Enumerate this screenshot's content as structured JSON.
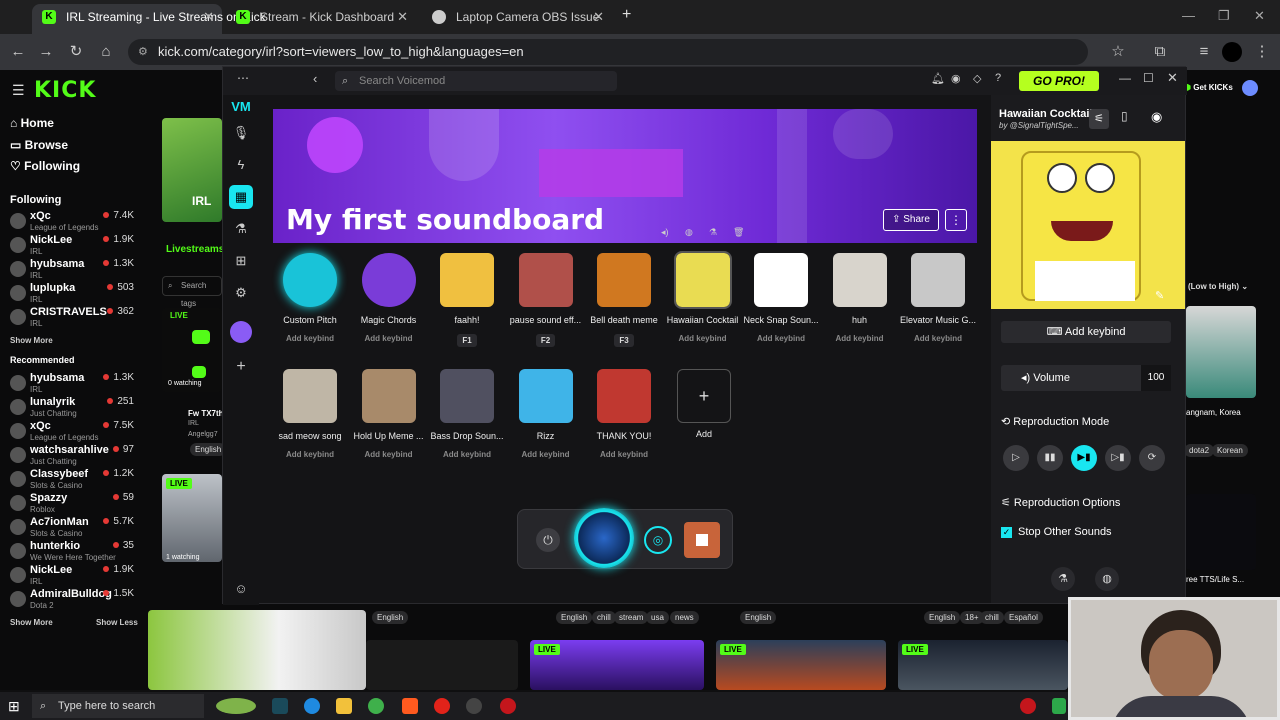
{
  "browser": {
    "tabs": [
      {
        "title": "IRL Streaming - Live Streams on Kick",
        "active": true
      },
      {
        "title": "Stream - Kick Dashboard",
        "active": false
      },
      {
        "title": "Laptop Camera OBS Issue",
        "active": false
      }
    ],
    "url": "kick.com/category/irl?sort=viewers_low_to_high&languages=en"
  },
  "kick": {
    "nav": [
      "Home",
      "Browse",
      "Following"
    ],
    "following_header": "Following",
    "following": [
      {
        "name": "xQc",
        "cat": "League of Legends",
        "viewers": "7.4K"
      },
      {
        "name": "NickLee",
        "cat": "IRL",
        "viewers": "1.9K"
      },
      {
        "name": "hyubsama",
        "cat": "IRL",
        "viewers": "1.3K"
      },
      {
        "name": "luplupka",
        "cat": "IRL",
        "viewers": "503"
      },
      {
        "name": "CRISTRAVELS",
        "cat": "IRL",
        "viewers": "362"
      }
    ],
    "show_more": "Show More",
    "recommended_header": "Recommended",
    "recommended": [
      {
        "name": "hyubsama",
        "cat": "IRL",
        "viewers": "1.3K"
      },
      {
        "name": "lunalyrik",
        "cat": "Just Chatting",
        "viewers": "251"
      },
      {
        "name": "xQc",
        "cat": "League of Legends",
        "viewers": "7.5K"
      },
      {
        "name": "watchsarahlive",
        "cat": "Just Chatting",
        "viewers": "97"
      },
      {
        "name": "Classybeef",
        "cat": "Slots & Casino",
        "viewers": "1.2K"
      },
      {
        "name": "Spazzy",
        "cat": "Roblox",
        "viewers": "59"
      },
      {
        "name": "Ac7ionMan",
        "cat": "Slots & Casino",
        "viewers": "5.7K"
      },
      {
        "name": "hunterkio",
        "cat": "We Were Here Together",
        "viewers": "35"
      },
      {
        "name": "NickLee",
        "cat": "IRL",
        "viewers": "1.9K"
      },
      {
        "name": "AdmiralBulldog",
        "cat": "Dota 2",
        "viewers": "1.5K"
      }
    ],
    "show_less": "Show Less",
    "irl_label": "IRL",
    "livestreams_label": "Livestreams",
    "search_tags_placeholder": "Search tags",
    "live": "LIVE",
    "watching_0": "0 watching",
    "watching_1": "1 watching",
    "card_title": "Fw TX7th",
    "card_cat": "IRL",
    "card_user": "Angelgg7",
    "lang_english": "English",
    "get_kicks": "Get KICKs",
    "sort_label": "(Low to High)",
    "right_card_text": "angnam, Korea",
    "right_tags": [
      "dota2",
      "Korean"
    ],
    "right_card2_text": "ree TTS/Life S...",
    "bottom_tags": [
      "English",
      "English",
      "chill",
      "stream",
      "usa",
      "news",
      "English",
      "English",
      "18+",
      "chill",
      "Español"
    ]
  },
  "voicemod": {
    "search_placeholder": "Search Voicemod",
    "gopro": "GO PRO!",
    "soundboard_title": "My first soundboard",
    "share": "Share",
    "sounds": [
      {
        "label": "Custom Pitch",
        "key": "Add keybind",
        "color": "#19c3d8"
      },
      {
        "label": "Magic Chords",
        "key": "Add keybind",
        "color": "#7a3cd8"
      },
      {
        "label": "faahh!",
        "key": "F1",
        "color": "#f0c040"
      },
      {
        "label": "pause sound eff...",
        "key": "F2",
        "color": "#b0504a"
      },
      {
        "label": "Bell death meme",
        "key": "F3",
        "color": "#d07820"
      },
      {
        "label": "Hawaiian Cocktail",
        "key": "Add keybind",
        "color": "#e9dc52"
      },
      {
        "label": "Neck Snap Soun...",
        "key": "Add keybind",
        "color": "#ffffff"
      },
      {
        "label": "huh",
        "key": "Add keybind",
        "color": "#d8d4cc"
      },
      {
        "label": "Elevator Music G...",
        "key": "Add keybind",
        "color": "#c8c8c8"
      },
      {
        "label": "sad meow song",
        "key": "Add keybind",
        "color": "#bfb6a6"
      },
      {
        "label": "Hold Up Meme ...",
        "key": "Add keybind",
        "color": "#a88a6a"
      },
      {
        "label": "Bass Drop Soun...",
        "key": "Add keybind",
        "color": "#505060"
      },
      {
        "label": "Rizz",
        "key": "Add keybind",
        "color": "#3fb4e8"
      },
      {
        "label": "THANK YOU!",
        "key": "Add keybind",
        "color": "#c03830"
      }
    ],
    "add": "Add",
    "panel": {
      "title": "Hawaiian Cocktail",
      "author": "by @SignalTightSpe...",
      "add_keybind": "Add keybind",
      "volume_label": "Volume",
      "volume_value": "100",
      "repro_mode": "Reproduction Mode",
      "repro_options": "Reproduction Options",
      "stop_other": "Stop Other Sounds"
    }
  },
  "taskbar": {
    "search": "Type here to search"
  }
}
